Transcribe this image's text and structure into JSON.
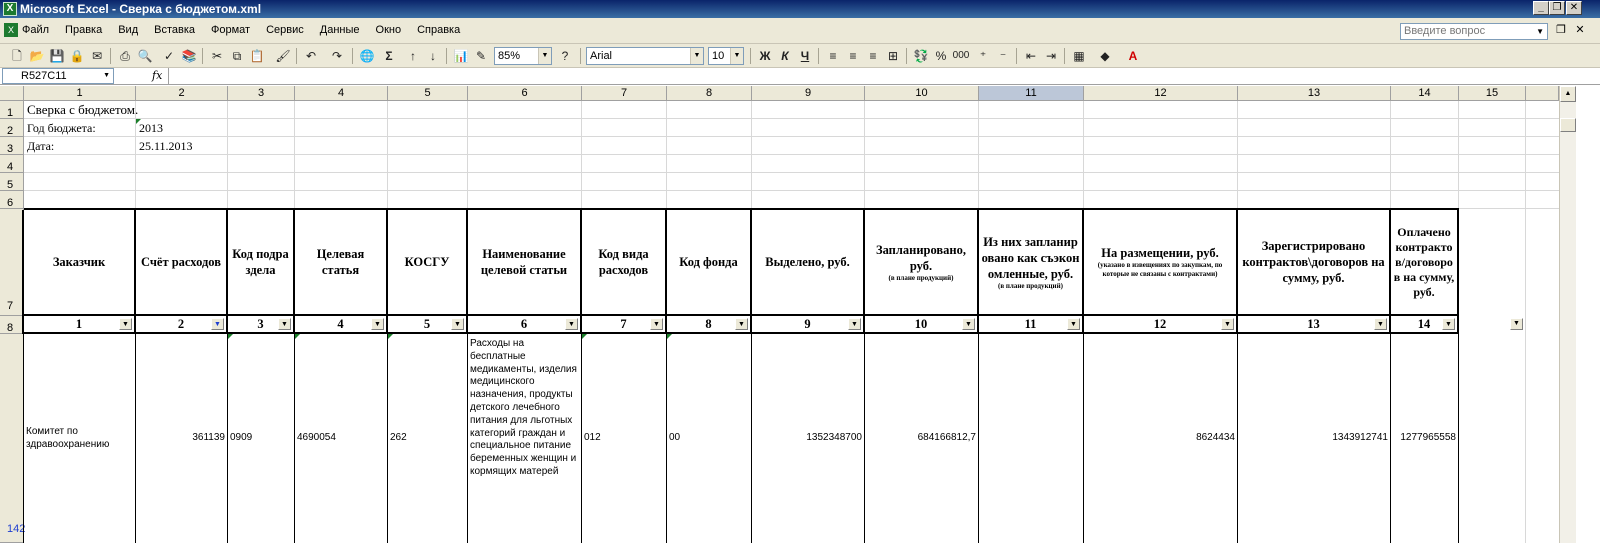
{
  "window": {
    "title": "Microsoft Excel - Сверка с бюджетом.xml",
    "app_icon": "X",
    "controls": [
      "_",
      "❐",
      "✕"
    ]
  },
  "menu": {
    "items": [
      "Файл",
      "Правка",
      "Вид",
      "Вставка",
      "Формат",
      "Сервис",
      "Данные",
      "Окно",
      "Справка"
    ],
    "help_placeholder": "Введите вопрос"
  },
  "toolbar": {
    "zoom": "85%",
    "font_name": "Arial",
    "font_size": "10",
    "bold": "Ж",
    "italic": "К",
    "underline": "Ч",
    "percent": "%",
    "thousands": "000",
    "sigma": "Σ"
  },
  "formula_bar": {
    "name_box": "R527C11",
    "fx": "fx",
    "formula": ""
  },
  "grid": {
    "columns": [
      "1",
      "2",
      "3",
      "4",
      "5",
      "6",
      "7",
      "8",
      "9",
      "10",
      "11",
      "12",
      "13",
      "14",
      "15"
    ],
    "selected_column": "11",
    "rows": [
      "1",
      "2",
      "3",
      "4",
      "5",
      "6",
      "7",
      "8",
      "142"
    ],
    "cells": {
      "r1c1": "Сверка с бюджетом.",
      "r2c1": "Год бюджета:",
      "r2c2": "2013",
      "r3c1": "Дата:",
      "r3c2": "25.11.2013"
    },
    "header_row": [
      "Заказчик",
      "Счёт расходов",
      "Код подраздела",
      "Целевая статья",
      "КОСГУ",
      "Наименование целевой статьи",
      "Код вида расходов",
      "Код фонда",
      "Выделено, руб.",
      "Запланировано, руб.",
      "Из них запланировано как съэкономленные, руб.",
      "На размещении, руб.",
      "Зарегистрировано контрактов\\договоров на сумму, руб.",
      "Оплачено контрактов/договоров на сумму, руб."
    ],
    "header_notes": {
      "c10": "(в плане продукций)",
      "c11": "(в плане продукций)",
      "c12": "(указано в извещениях по закупкам, по которые не связаны с контрактами)"
    },
    "number_row": [
      "1",
      "2",
      "3",
      "4",
      "5",
      "6",
      "7",
      "8",
      "9",
      "10",
      "11",
      "12",
      "13",
      "14"
    ],
    "data_row": [
      "Комитет по здравоохранению",
      "361139",
      "0909",
      "4690054",
      "262",
      "Расходы на бесплатные медикаменты, изделия медицинского назначения, продукты детского лечебного питания для льготных категорий граждан и специальное питание беременных женщин и кормящих матерей",
      "012",
      "00",
      "1352348700",
      "684166812,7",
      "",
      "8624434",
      "1343912741",
      "1277965558"
    ]
  }
}
